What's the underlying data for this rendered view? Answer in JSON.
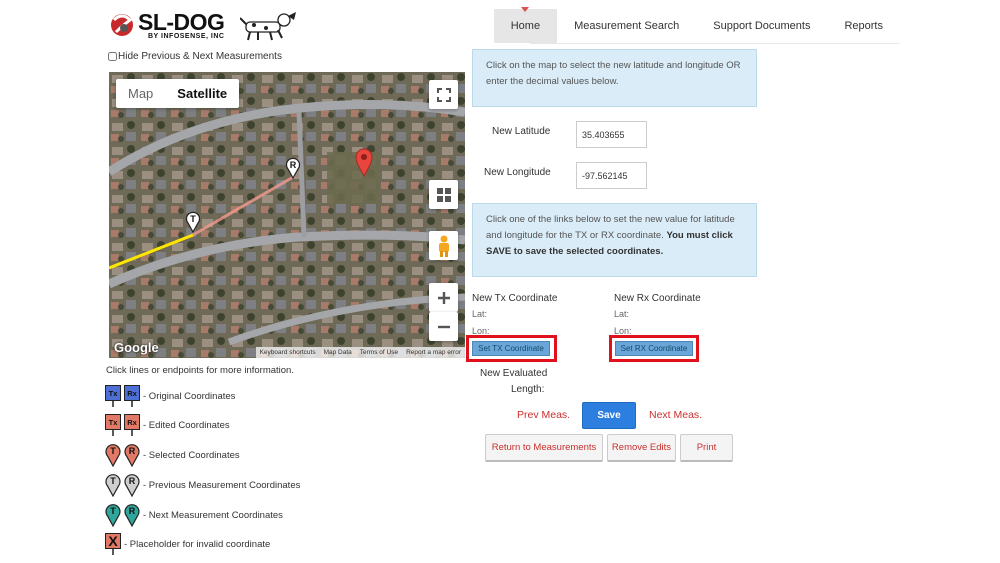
{
  "header": {
    "logo_text": "SL-DOG",
    "logo_sub": "BY INFOSENSE, INC",
    "nav": [
      "Home",
      "Measurement Search",
      "Support Documents",
      "Reports"
    ]
  },
  "hide_label": "Hide Previous & Next Measurements",
  "map": {
    "type_map": "Map",
    "type_satellite": "Satellite",
    "google": "Google",
    "attribution": [
      "Keyboard shortcuts",
      "Map Data",
      "Terms of Use",
      "Report a map error"
    ],
    "marker_t": "T",
    "marker_r": "R"
  },
  "legend": {
    "title": "Click lines or endpoints for more information.",
    "items": [
      {
        "label": "- Original Coordinates",
        "t": "Tx",
        "r": "Rx"
      },
      {
        "label": "- Edited Coordinates",
        "t": "Tx",
        "r": "Rx"
      },
      {
        "label": "- Selected Coordinates",
        "t": "T",
        "r": "R"
      },
      {
        "label": "- Previous Measurement Coordinates",
        "t": "T",
        "r": "R"
      },
      {
        "label": "- Next Measurement Coordinates",
        "t": "T",
        "r": "R"
      },
      {
        "label": "- Placeholder for invalid coordinate",
        "t": "X"
      }
    ],
    "colors": {
      "original": "#4d6fd6",
      "edited": "#e27866",
      "selected": "#e27866",
      "previous": "#cfcfcf",
      "next": "#2fa59c",
      "invalid": "#e27866"
    }
  },
  "info1": "Click on the map to select the new latitude and longitude OR enter the decimal values below.",
  "fields": {
    "lat_label": "New Latitude",
    "lat_value": "35.403655",
    "lon_label": "New Longitude",
    "lon_value": "-97.562145"
  },
  "info2": {
    "text": "Click one of the links below to set the new value for latitude and longitude for the TX or RX coordinate.",
    "bold": "You must click SAVE to save the selected coordinates."
  },
  "tx": {
    "title": "New Tx Coordinate",
    "lat": "Lat:",
    "lon": "Lon:",
    "button": "Set TX Coordinate"
  },
  "rx": {
    "title": "New Rx Coordinate",
    "lat": "Lat:",
    "lon": "Lon:",
    "button": "Set RX Coordinate"
  },
  "evaluated_length": {
    "line1": "New Evaluated",
    "line2": "Length:"
  },
  "actions": {
    "prev": "Prev Meas.",
    "save": "Save",
    "next": "Next Meas.",
    "return": "Return to Measurements",
    "remove": "Remove Edits",
    "print": "Print"
  }
}
